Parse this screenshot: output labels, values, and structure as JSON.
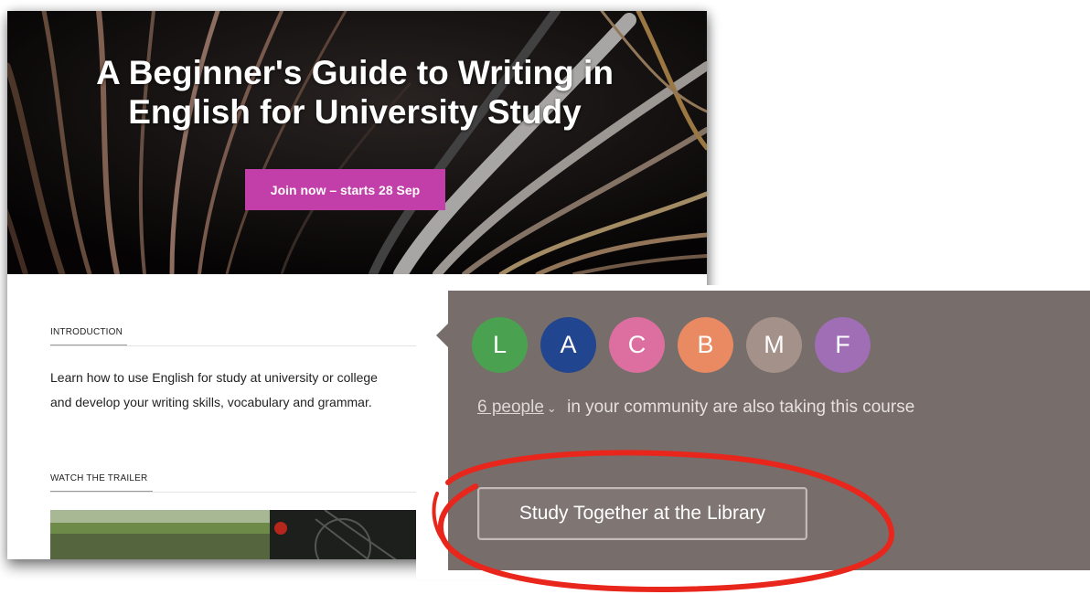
{
  "course": {
    "title": "A Beginner's Guide to Writing in English for University Study",
    "join_label": "Join now – starts 28 Sep"
  },
  "introduction": {
    "heading": "INTRODUCTION",
    "text": "Learn how to use English for study at university or college and develop your writing skills, vocabulary and grammar."
  },
  "trailer": {
    "heading": "WATCH THE TRAILER"
  },
  "community": {
    "avatars": [
      {
        "letter": "L",
        "color": "#4aa250"
      },
      {
        "letter": "A",
        "color": "#22458f"
      },
      {
        "letter": "C",
        "color": "#dd6fa0"
      },
      {
        "letter": "B",
        "color": "#e98a63"
      },
      {
        "letter": "M",
        "color": "#a4928a"
      },
      {
        "letter": "F",
        "color": "#a06eb5"
      }
    ],
    "people_count": "6 people",
    "people_suffix": "in your community are also taking this course",
    "study_button_label": "Study Together at the Library"
  },
  "colors": {
    "join_button": "#c23fa9",
    "popover_bg": "#776d6a",
    "annotation_circle": "#e8261c"
  }
}
